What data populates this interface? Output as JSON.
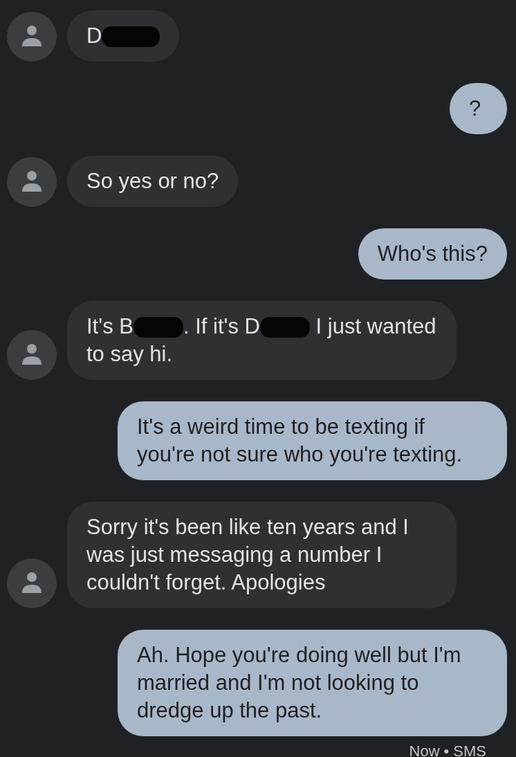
{
  "messages": [
    {
      "kind": "incoming",
      "segments": [
        {
          "kind": "text",
          "text": "D"
        },
        {
          "kind": "redaction"
        }
      ]
    },
    {
      "kind": "outgoing",
      "segments": [
        {
          "kind": "text",
          "text": "?"
        }
      ]
    },
    {
      "kind": "incoming",
      "segments": [
        {
          "kind": "text",
          "text": "So yes or no?"
        }
      ]
    },
    {
      "kind": "outgoing",
      "segments": [
        {
          "kind": "text",
          "text": "Who's this?"
        }
      ]
    },
    {
      "kind": "incoming",
      "segments": [
        {
          "kind": "text",
          "text": "It's B"
        },
        {
          "kind": "redaction"
        },
        {
          "kind": "text",
          "text": ". If it's D"
        },
        {
          "kind": "redaction"
        },
        {
          "kind": "text",
          "text": " I just wanted to say hi."
        }
      ]
    },
    {
      "kind": "outgoing",
      "segments": [
        {
          "kind": "text",
          "text": "It's a weird time to be texting if you're not sure who you're texting."
        }
      ]
    },
    {
      "kind": "incoming",
      "segments": [
        {
          "kind": "text",
          "text": "Sorry it's been like ten years and I was just messaging a number I couldn't forget. Apologies"
        }
      ]
    },
    {
      "kind": "outgoing",
      "segments": [
        {
          "kind": "text",
          "text": "Ah. Hope you're doing well but I'm married and I'm not looking to dredge up the past."
        }
      ]
    }
  ],
  "status": {
    "time": "Now",
    "separator": "•",
    "channel": "SMS"
  }
}
